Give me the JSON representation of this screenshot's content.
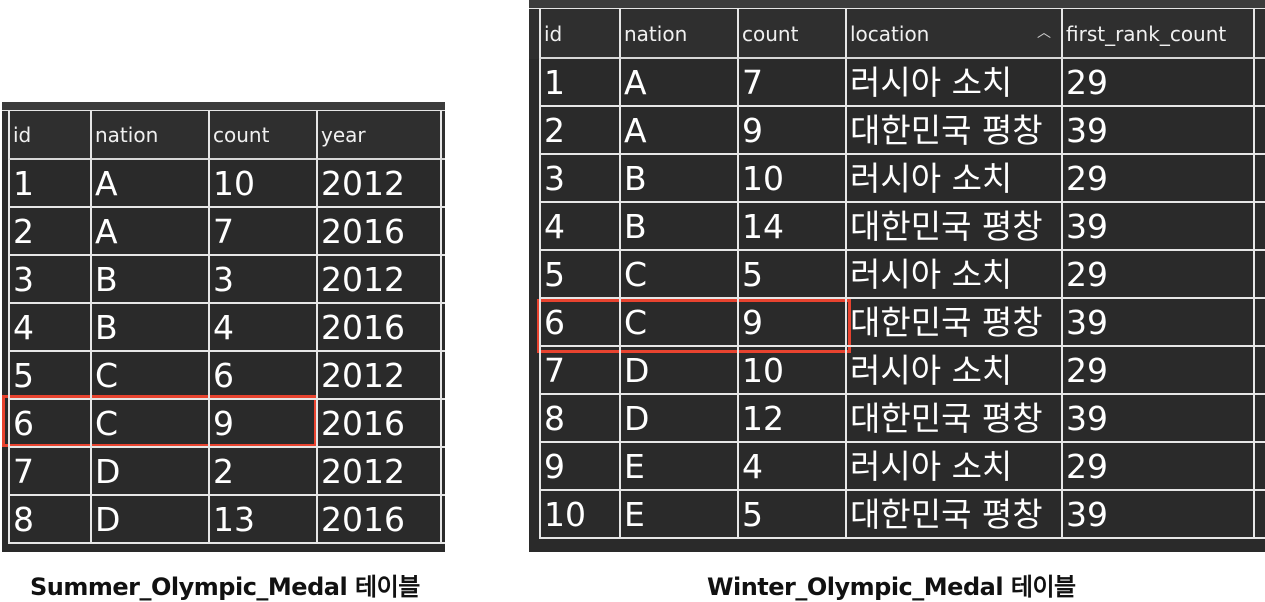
{
  "summer": {
    "caption": "Summer_Olympic_Medal 테이블",
    "columns": [
      "id",
      "nation",
      "count",
      "year"
    ],
    "rows": [
      [
        "1",
        "A",
        "10",
        "2012"
      ],
      [
        "2",
        "A",
        "7",
        "2016"
      ],
      [
        "3",
        "B",
        "3",
        "2012"
      ],
      [
        "4",
        "B",
        "4",
        "2016"
      ],
      [
        "5",
        "C",
        "6",
        "2012"
      ],
      [
        "6",
        "C",
        "9",
        "2016"
      ],
      [
        "7",
        "D",
        "2",
        "2012"
      ],
      [
        "8",
        "D",
        "13",
        "2016"
      ]
    ],
    "highlighted_row": 6
  },
  "winter": {
    "caption": "Winter_Olympic_Medal 테이블",
    "columns": [
      "id",
      "nation",
      "count",
      "location",
      "first_rank_count"
    ],
    "sorted_column": "location",
    "sort_icon": "chevron-up-icon",
    "rows": [
      [
        "1",
        "A",
        "7",
        "러시아 소치",
        "29"
      ],
      [
        "2",
        "A",
        "9",
        "대한민국 평창",
        "39"
      ],
      [
        "3",
        "B",
        "10",
        "러시아 소치",
        "29"
      ],
      [
        "4",
        "B",
        "14",
        "대한민국 평창",
        "39"
      ],
      [
        "5",
        "C",
        "5",
        "러시아 소치",
        "29"
      ],
      [
        "6",
        "C",
        "9",
        "대한민국 평창",
        "39"
      ],
      [
        "7",
        "D",
        "10",
        "러시아 소치",
        "29"
      ],
      [
        "8",
        "D",
        "12",
        "대한민국 평창",
        "39"
      ],
      [
        "9",
        "E",
        "4",
        "러시아 소치",
        "29"
      ],
      [
        "10",
        "E",
        "5",
        "대한민국 평창",
        "39"
      ]
    ],
    "highlighted_row": 6
  },
  "colors": {
    "table_bg": "#2a2a2a",
    "grid": "#e6e6e6",
    "highlight": "#e8432f",
    "text": "#ffffff"
  }
}
